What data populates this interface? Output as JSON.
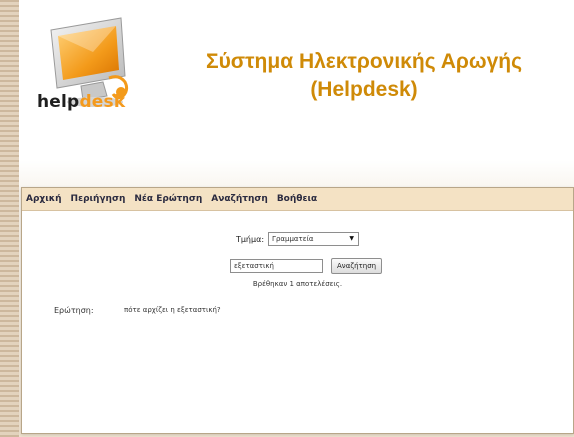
{
  "branding": {
    "logo_help": "help",
    "logo_desk": "desk",
    "title_line1": "Σύστημα Ηλεκτρονικής Αρωγής",
    "title_line2": "(Helpdesk)"
  },
  "nav": {
    "items": [
      {
        "label": "Αρχική"
      },
      {
        "label": "Περιήγηση"
      },
      {
        "label": "Νέα Ερώτηση"
      },
      {
        "label": "Αναζήτηση"
      },
      {
        "label": "Βοήθεια"
      }
    ]
  },
  "filter": {
    "label": "Τμήμα:",
    "selected": "Γραμματεία"
  },
  "search": {
    "value": "εξεταστική",
    "button_label": "Αναζήτηση",
    "result_count": "Βρέθηκαν 1 αποτελέσεις."
  },
  "results": [
    {
      "label": "Ερώτηση:",
      "text": "πότε αρχίζει η εξεταστική?"
    }
  ],
  "colors": {
    "accent": "#f49a1d",
    "title": "#cf8a07",
    "navbar": "#f4e2c4",
    "background": "#efe2cf"
  }
}
